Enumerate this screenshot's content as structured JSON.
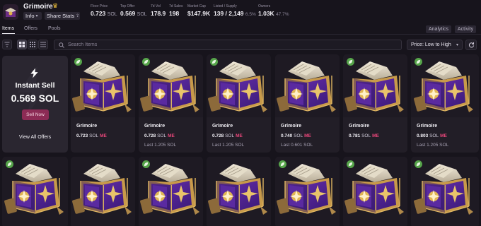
{
  "collection": {
    "name": "Grimoire",
    "info_label": "Info",
    "share_label": "Share Stats"
  },
  "stats": [
    {
      "label": "Floor Price",
      "value": "0.723",
      "unit": "SOL",
      "pct": ""
    },
    {
      "label": "Top Offer",
      "value": "0.569",
      "unit": "SOL",
      "pct": ""
    },
    {
      "label": "7d Vol",
      "value": "178.9",
      "unit": "",
      "pct": ""
    },
    {
      "label": "7d Sales",
      "value": "198",
      "unit": "",
      "pct": ""
    },
    {
      "label": "Market Cap",
      "value": "$147.9K",
      "unit": "",
      "pct": ""
    },
    {
      "label": "Listed / Supply",
      "value": "139 / 2,149",
      "unit": "",
      "pct": "6.5%"
    },
    {
      "label": "Owners",
      "value": "1.03K",
      "unit": "",
      "pct": "47.7%"
    }
  ],
  "tabs": [
    "Items",
    "Offers",
    "Pools"
  ],
  "right_buttons": {
    "analytics": "Analytics",
    "activity": "Activity"
  },
  "search": {
    "placeholder": "Search Items",
    "value": ""
  },
  "sort": {
    "selected": "Price: Low to High"
  },
  "instant_sell": {
    "title": "Instant Sell",
    "price": "0.569 SOL",
    "sell_label": "Sell Now",
    "view_label": "View All Offers"
  },
  "items": [
    {
      "name": "Grimoire",
      "price": "0.723",
      "unit": "SOL",
      "last": ""
    },
    {
      "name": "Grimoire",
      "price": "0.728",
      "unit": "SOL",
      "last": "Last 1.205 SOL"
    },
    {
      "name": "Grimoire",
      "price": "0.728",
      "unit": "SOL",
      "last": "Last 1.205 SOL"
    },
    {
      "name": "Grimoire",
      "price": "0.740",
      "unit": "SOL",
      "last": "Last 0.601 SOL"
    },
    {
      "name": "Grimoire",
      "price": "0.781",
      "unit": "SOL",
      "last": ""
    },
    {
      "name": "Grimoire",
      "price": "0.803",
      "unit": "SOL",
      "last": "Last 1.205 SOL"
    }
  ],
  "marketplace_tag": "ME",
  "colors": {
    "accent": "#8c2b55",
    "me_tag": "#e8467a",
    "listed_badge": "#56a44a"
  }
}
